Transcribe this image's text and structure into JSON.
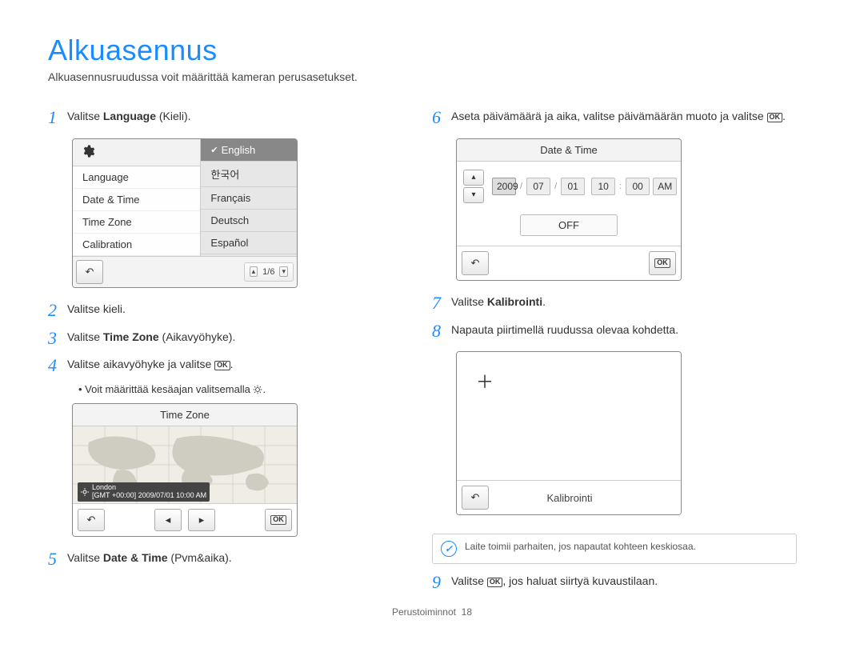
{
  "title": "Alkuasennus",
  "subtitle": "Alkuasennusruudussa voit määrittää kameran perusasetukset.",
  "steps": {
    "s1": {
      "pre": "Valitse ",
      "bold": "Language",
      "post": " (Kieli)."
    },
    "s2": "Valitse kieli.",
    "s3": {
      "pre": "Valitse ",
      "bold": "Time Zone",
      "post": " (Aikavyöhyke)."
    },
    "s4": {
      "pre": "Valitse aikavyöhyke ja valitse ",
      "post": "."
    },
    "s4_note": "Voit määrittää kesäajan valitsemalla ",
    "s5": {
      "pre": "Valitse ",
      "bold": "Date & Time",
      "post": " (Pvm&aika)."
    },
    "s6": {
      "pre": "Aseta päivämäärä ja aika, valitse päivämäärän muoto ja valitse ",
      "post": "."
    },
    "s7": {
      "pre": "Valitse ",
      "bold": "Kalibrointi",
      "post": "."
    },
    "s8": "Napauta piirtimellä ruudussa olevaa kohdetta.",
    "s9": {
      "pre": "Valitse ",
      "post": ", jos haluat siirtyä kuvaustilaan."
    }
  },
  "nums": {
    "n1": "1",
    "n2": "2",
    "n3": "3",
    "n4": "4",
    "n5": "5",
    "n6": "6",
    "n7": "7",
    "n8": "8",
    "n9": "9"
  },
  "ok_text": "OK",
  "lang_screen": {
    "menu": [
      "Language",
      "Date & Time",
      "Time Zone",
      "Calibration"
    ],
    "langs": [
      "English",
      "한국어",
      "Français",
      "Deutsch",
      "Español"
    ],
    "pager": "1/6"
  },
  "tz_screen": {
    "title": "Time Zone",
    "city": "London",
    "gmt": "[GMT +00:00] 2009/07/01 10:00 AM"
  },
  "dt_screen": {
    "title": "Date & Time",
    "year": "2009",
    "mon": "07",
    "day": "01",
    "hour": "10",
    "min": "00",
    "ampm": "AM",
    "off": "OFF"
  },
  "cal_screen": {
    "label": "Kalibrointi"
  },
  "info": "Laite toimii parhaiten, jos napautat kohteen keskiosaa.",
  "footer_section": "Perustoiminnot",
  "footer_page": "18"
}
